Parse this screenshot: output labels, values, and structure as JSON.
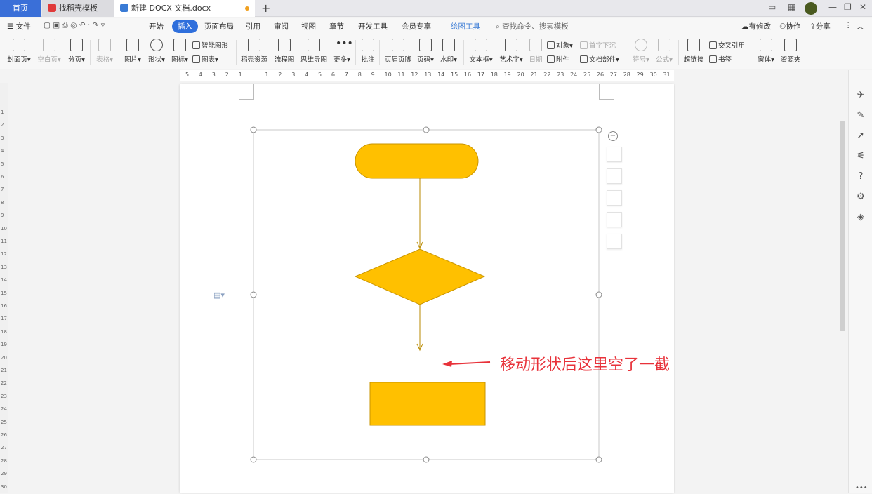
{
  "tabs": {
    "home": "首页",
    "template": "找稻壳模板",
    "document": "新建 DOCX 文档.docx"
  },
  "menu": {
    "file": "文件",
    "items": [
      "开始",
      "插入",
      "页面布局",
      "引用",
      "审阅",
      "视图",
      "章节",
      "开发工具",
      "会员专享",
      "绘图工具"
    ],
    "search_placeholder": "查找命令、搜索模板",
    "has_changes": "有修改",
    "collaborate": "协作",
    "share": "分享"
  },
  "ribbon": {
    "cover": "封面页",
    "blank": "空白页",
    "pagebreak": "分页",
    "table": "表格",
    "picture": "图片",
    "shape": "形状",
    "icon": "图标",
    "smart_art": "智能图形",
    "chart": "图表",
    "docer": "稻壳资源",
    "flowchart": "流程图",
    "mindmap": "思维导图",
    "more": "更多",
    "comment": "批注",
    "header_footer": "页眉页脚",
    "page_number": "页码",
    "watermark": "水印",
    "textbox": "文本框",
    "wordart": "艺术字",
    "date": "日期",
    "object": "对象",
    "attachment": "附件",
    "dropcap": "首字下沉",
    "doc_parts": "文档部件",
    "symbol": "符号",
    "formula": "公式",
    "hyperlink": "超链接",
    "crossref": "交叉引用",
    "bookmark": "书签",
    "form": "窗体",
    "resource": "资源夹"
  },
  "ruler_numbers": [
    "5",
    "4",
    "3",
    "2",
    "1",
    "",
    "1",
    "2",
    "3",
    "4",
    "5",
    "6",
    "7",
    "8",
    "9",
    "10",
    "11",
    "12",
    "13",
    "14",
    "15",
    "16",
    "17",
    "18",
    "19",
    "20",
    "21",
    "22",
    "23",
    "24",
    "25",
    "26",
    "27",
    "28",
    "29",
    "30",
    "31"
  ],
  "vruler_numbers": [
    "1",
    "2",
    "3",
    "4",
    "5",
    "6",
    "7",
    "8",
    "9",
    "10",
    "11",
    "12",
    "13",
    "14",
    "15",
    "16",
    "17",
    "18",
    "19",
    "20",
    "21",
    "22",
    "23",
    "24",
    "25",
    "26",
    "27",
    "28",
    "29",
    "30"
  ],
  "annotation": {
    "text": "移动形状后这里空了一截",
    "color": "#e8323a"
  },
  "colors": {
    "shape_fill": "#ffc000",
    "shape_stroke": "#c99400",
    "accent": "#2f6fdc"
  }
}
